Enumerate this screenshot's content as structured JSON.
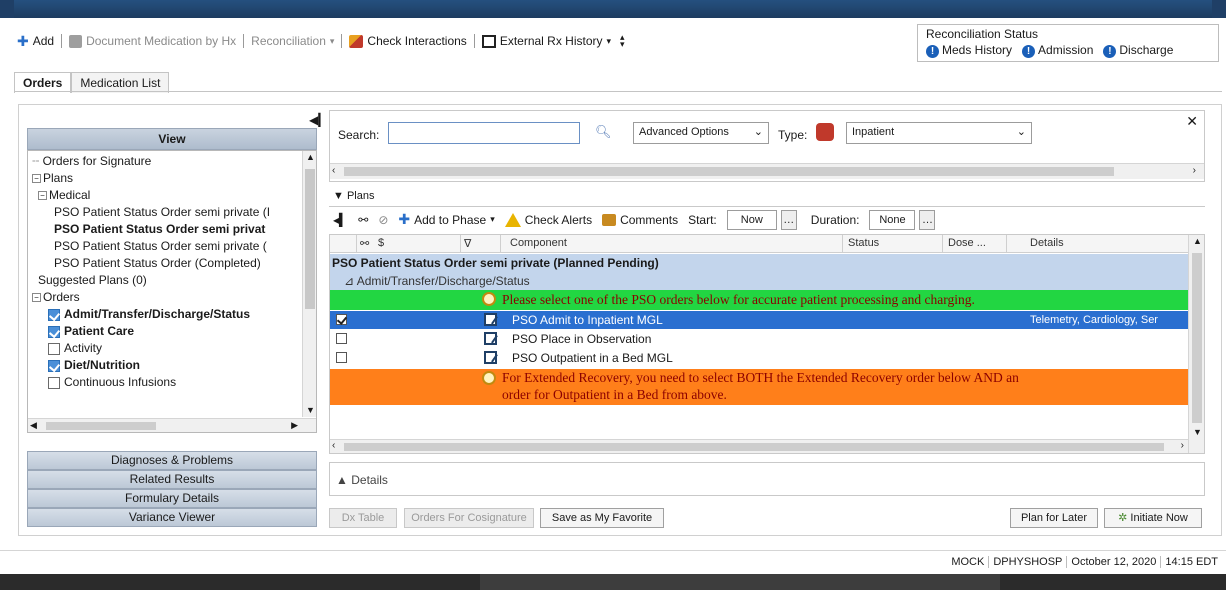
{
  "toolbar": {
    "add": "Add",
    "document_medication": "Document Medication by Hx",
    "reconciliation": "Reconciliation",
    "check_interactions": "Check Interactions",
    "external_rx_history": "External Rx History"
  },
  "reconciliation_status": {
    "title": "Reconciliation Status",
    "items": [
      "Meds History",
      "Admission",
      "Discharge"
    ]
  },
  "tabs": [
    "Orders",
    "Medication List"
  ],
  "left": {
    "view_header": "View",
    "tree": [
      "Orders for Signature",
      "Plans",
      "Medical",
      "PSO Patient Status Order semi private (I",
      "PSO Patient Status Order semi privat",
      "PSO Patient Status Order semi private (",
      "PSO Patient Status Order (Completed)",
      "Suggested Plans (0)",
      "Orders",
      "Admit/Transfer/Discharge/Status",
      "Patient Care",
      "Activity",
      "Diet/Nutrition",
      "Continuous Infusions"
    ],
    "accordion": [
      "Diagnoses & Problems",
      "Related Results",
      "Formulary Details",
      "Variance Viewer"
    ]
  },
  "search": {
    "label": "Search:",
    "value": "",
    "advanced_options": "Advanced Options",
    "type_label": "Type:",
    "type_value": "Inpatient"
  },
  "plans": {
    "title": "Plans",
    "add_to_phase": "Add to Phase",
    "check_alerts": "Check Alerts",
    "comments": "Comments",
    "start_label": "Start:",
    "start_value": "Now",
    "duration_label": "Duration:",
    "duration_value": "None",
    "columns": [
      "$",
      "Component",
      "Status",
      "Dose ...",
      "Details"
    ],
    "plan_name": "PSO Patient Status Order semi private (Planned Pending)",
    "category": "Admit/Transfer/Discharge/Status",
    "note_1": "Please select one of the PSO orders below for accurate patient processing and charging.",
    "rows": [
      {
        "component": "PSO Admit to Inpatient MGL",
        "details": "Telemetry, Cardiology, Ser"
      },
      {
        "component": "PSO Place in Observation",
        "details": ""
      },
      {
        "component": "PSO Outpatient in a Bed MGL",
        "details": ""
      }
    ],
    "note_2_line1": "For Extended Recovery, you need to select BOTH the Extended Recovery order below AND an",
    "note_2_line2": "order for Outpatient in a Bed from above."
  },
  "details_label": "Details",
  "buttons": {
    "dx_table": "Dx Table",
    "orders_for_cosignature": "Orders For Cosignature",
    "save_favorite": "Save as My Favorite",
    "plan_for_later": "Plan for Later",
    "initiate_now": "Initiate Now"
  },
  "status_bar": [
    "MOCK",
    "DPHYSHOSP",
    "October 12, 2020",
    "14:15 EDT"
  ]
}
